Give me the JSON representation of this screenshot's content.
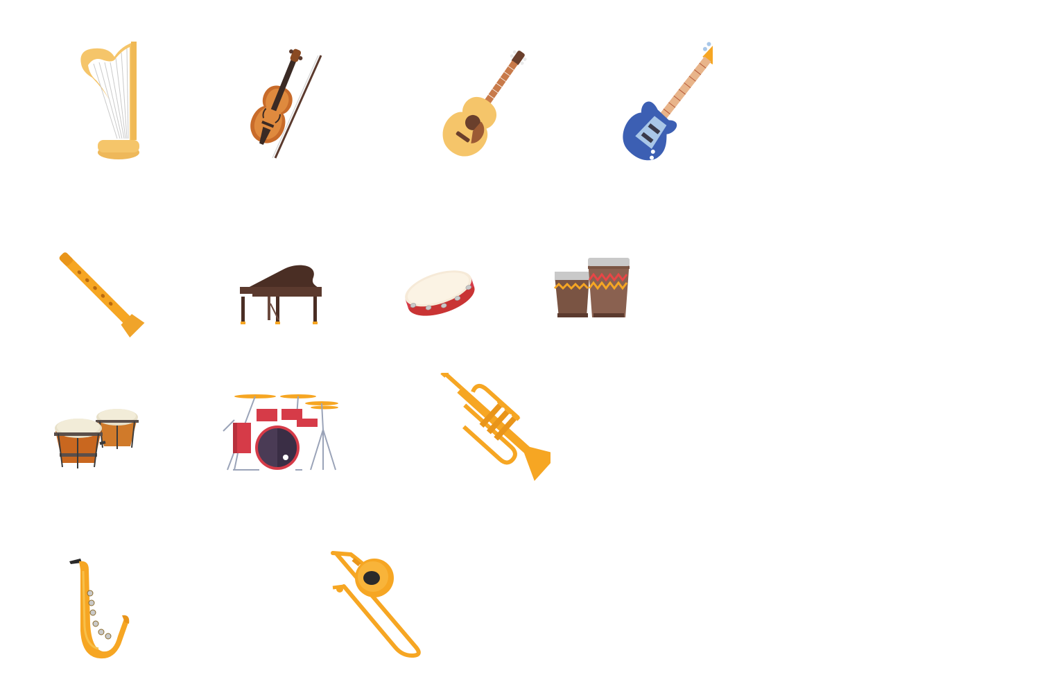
{
  "icons": [
    {
      "id": "harp",
      "name": "harp-icon"
    },
    {
      "id": "violin",
      "name": "violin-icon"
    },
    {
      "id": "guitar",
      "name": "acoustic-guitar-icon"
    },
    {
      "id": "bass",
      "name": "bass-guitar-icon"
    },
    {
      "id": "flute",
      "name": "recorder-flute-icon"
    },
    {
      "id": "piano",
      "name": "grand-piano-icon"
    },
    {
      "id": "tambourine",
      "name": "tambourine-icon"
    },
    {
      "id": "conga",
      "name": "conga-drums-icon"
    },
    {
      "id": "bongos",
      "name": "bongo-drums-icon"
    },
    {
      "id": "drumkit",
      "name": "drum-kit-icon"
    },
    {
      "id": "trumpet",
      "name": "trumpet-icon"
    },
    {
      "id": "sax",
      "name": "saxophone-icon"
    },
    {
      "id": "trombone",
      "name": "trombone-icon"
    }
  ],
  "colors": {
    "background": "#ffffff",
    "gold": "#f5c56a",
    "brass": "#f6a623",
    "wood": "#b9652a",
    "dark_wood": "#4a2e24",
    "bass_blue": "#3c5fb3",
    "drum_red": "#d63b48",
    "conga_brown": "#7a5443"
  }
}
